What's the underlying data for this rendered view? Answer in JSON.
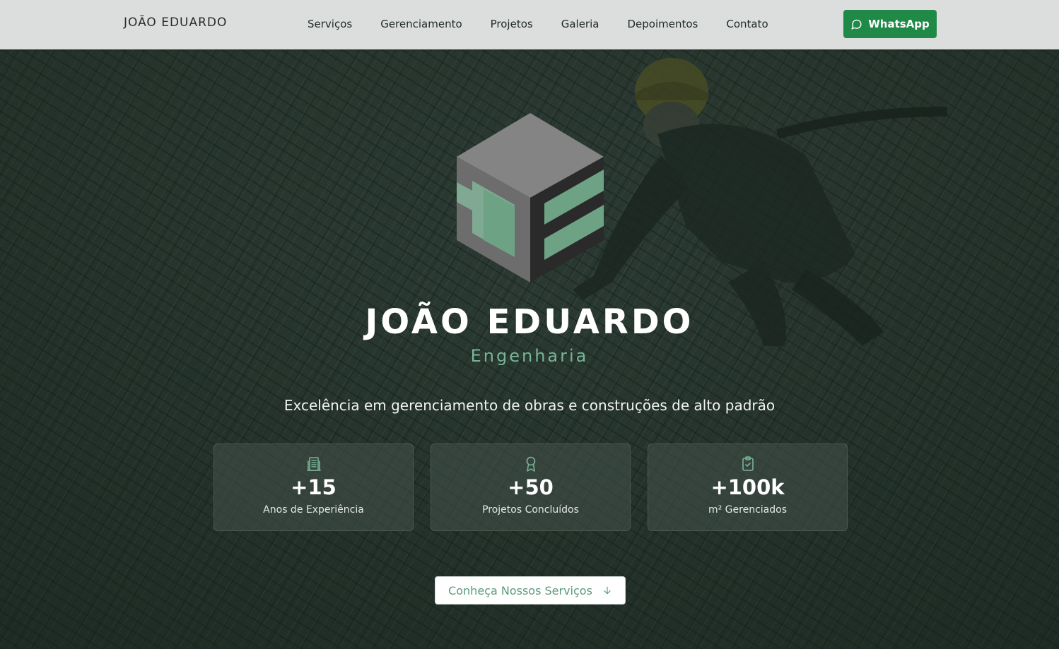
{
  "nav": {
    "brand": "JOÃO EDUARDO",
    "links": [
      "Serviços",
      "Gerenciamento",
      "Projetos",
      "Galeria",
      "Depoimentos",
      "Contato"
    ],
    "whatsapp_label": "WhatsApp"
  },
  "hero": {
    "title": "JOÃO EDUARDO",
    "subtitle": "Engenharia",
    "tagline": "Excelência em gerenciamento de obras e construções de alto padrão",
    "stats": [
      {
        "icon": "building-icon",
        "value": "+15",
        "label": "Anos de Experiência"
      },
      {
        "icon": "award-icon",
        "value": "+50",
        "label": "Projetos Concluídos"
      },
      {
        "icon": "clipboard-check-icon",
        "value": "+100k",
        "label": "m² Gerenciados"
      }
    ],
    "cta_label": "Conheça Nossos Serviços"
  },
  "colors": {
    "accent_green": "#78b497",
    "whatsapp_green": "#1f8a47",
    "navbar_bg": "#dcdedd"
  }
}
